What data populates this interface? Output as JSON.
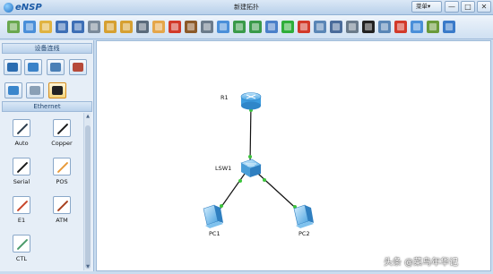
{
  "app": {
    "logo_text": "eNSP",
    "window_title": "新建拓扑",
    "menu_label": "菜单▾"
  },
  "window_controls": [
    "—",
    "□",
    "✕"
  ],
  "toolbar": {
    "icons": [
      {
        "name": "add-topology-icon",
        "color": "#6aa84f"
      },
      {
        "name": "new-topology-icon",
        "color": "#4a8fd9"
      },
      {
        "name": "open-icon",
        "color": "#e0b341"
      },
      {
        "name": "save-icon",
        "color": "#3d6fb6"
      },
      {
        "name": "save-as-icon",
        "color": "#3d6fb6"
      },
      {
        "name": "print-icon",
        "color": "#7a8a9a"
      },
      {
        "name": "undo-icon",
        "color": "#d6a031"
      },
      {
        "name": "redo-icon",
        "color": "#d6a031"
      },
      {
        "name": "select-icon",
        "color": "#5a6b7c"
      },
      {
        "name": "hand-icon",
        "color": "#e5a64a"
      },
      {
        "name": "delete-icon",
        "color": "#d23a2a"
      },
      {
        "name": "delete-link-icon",
        "color": "#8c5a2a"
      },
      {
        "name": "text-icon",
        "color": "#6b7b8b"
      },
      {
        "name": "rectangle-icon",
        "color": "#4a8fd9"
      },
      {
        "name": "zoom-in-icon",
        "color": "#3a9a4a"
      },
      {
        "name": "zoom-out-icon",
        "color": "#3a9a4a"
      },
      {
        "name": "fit-icon",
        "color": "#4a7fc9"
      },
      {
        "name": "start-icon",
        "color": "#2fae3a"
      },
      {
        "name": "stop-icon",
        "color": "#d23a2a"
      },
      {
        "name": "capture-icon",
        "color": "#5a86b6"
      },
      {
        "name": "cli-icon",
        "color": "#4a6b9a"
      },
      {
        "name": "frame-icon",
        "color": "#6a7a8a"
      },
      {
        "name": "terminal-icon",
        "color": "#222222"
      },
      {
        "name": "topology-icon",
        "color": "#5a86b6"
      },
      {
        "name": "huawei-icon",
        "color": "#d23a2a"
      },
      {
        "name": "chat-icon",
        "color": "#4a8fd9"
      },
      {
        "name": "settings-icon",
        "color": "#6a9a3a"
      },
      {
        "name": "help-icon",
        "color": "#3a7ac9"
      }
    ]
  },
  "left_panel": {
    "device_section_title": "设备连线",
    "device_icons": [
      {
        "name": "router-category-icon",
        "color": "#2b6cb0"
      },
      {
        "name": "switch-category-icon",
        "color": "#3a82c8"
      },
      {
        "name": "wlan-category-icon",
        "color": "#4a7fb6"
      },
      {
        "name": "firewall-category-icon",
        "color": "#b64a3a"
      },
      {
        "name": "pc-category-icon",
        "color": "#3a86cc"
      },
      {
        "name": "cloud-category-icon",
        "color": "#8aa0b6"
      },
      {
        "name": "cable-category-icon",
        "color": "#222222",
        "selected": true
      }
    ],
    "cable_section_title": "Ethernet",
    "cables": [
      {
        "label": "Auto",
        "color": "#2a3a4a"
      },
      {
        "label": "Copper",
        "color": "#1a1a1a"
      },
      {
        "label": "Serial",
        "color": "#1a1a1a"
      },
      {
        "label": "POS",
        "color": "#e89a3a"
      },
      {
        "label": "E1",
        "color": "#c8462a"
      },
      {
        "label": "ATM",
        "color": "#a8401e"
      },
      {
        "label": "CTL",
        "color": "#4a9a6a"
      }
    ]
  },
  "topology": {
    "nodes": [
      {
        "id": "R1",
        "label": "R1",
        "type": "router"
      },
      {
        "id": "LSW1",
        "label": "LSW1",
        "type": "switch"
      },
      {
        "id": "PC1",
        "label": "PC1",
        "type": "pc"
      },
      {
        "id": "PC2",
        "label": "PC2",
        "type": "pc"
      }
    ],
    "links": [
      {
        "from": "R1",
        "to": "LSW1"
      },
      {
        "from": "LSW1",
        "to": "PC1"
      },
      {
        "from": "LSW1",
        "to": "PC2"
      }
    ],
    "port_status_color": "#3cc43c"
  },
  "watermark": "头条 @菜鸟年华记"
}
